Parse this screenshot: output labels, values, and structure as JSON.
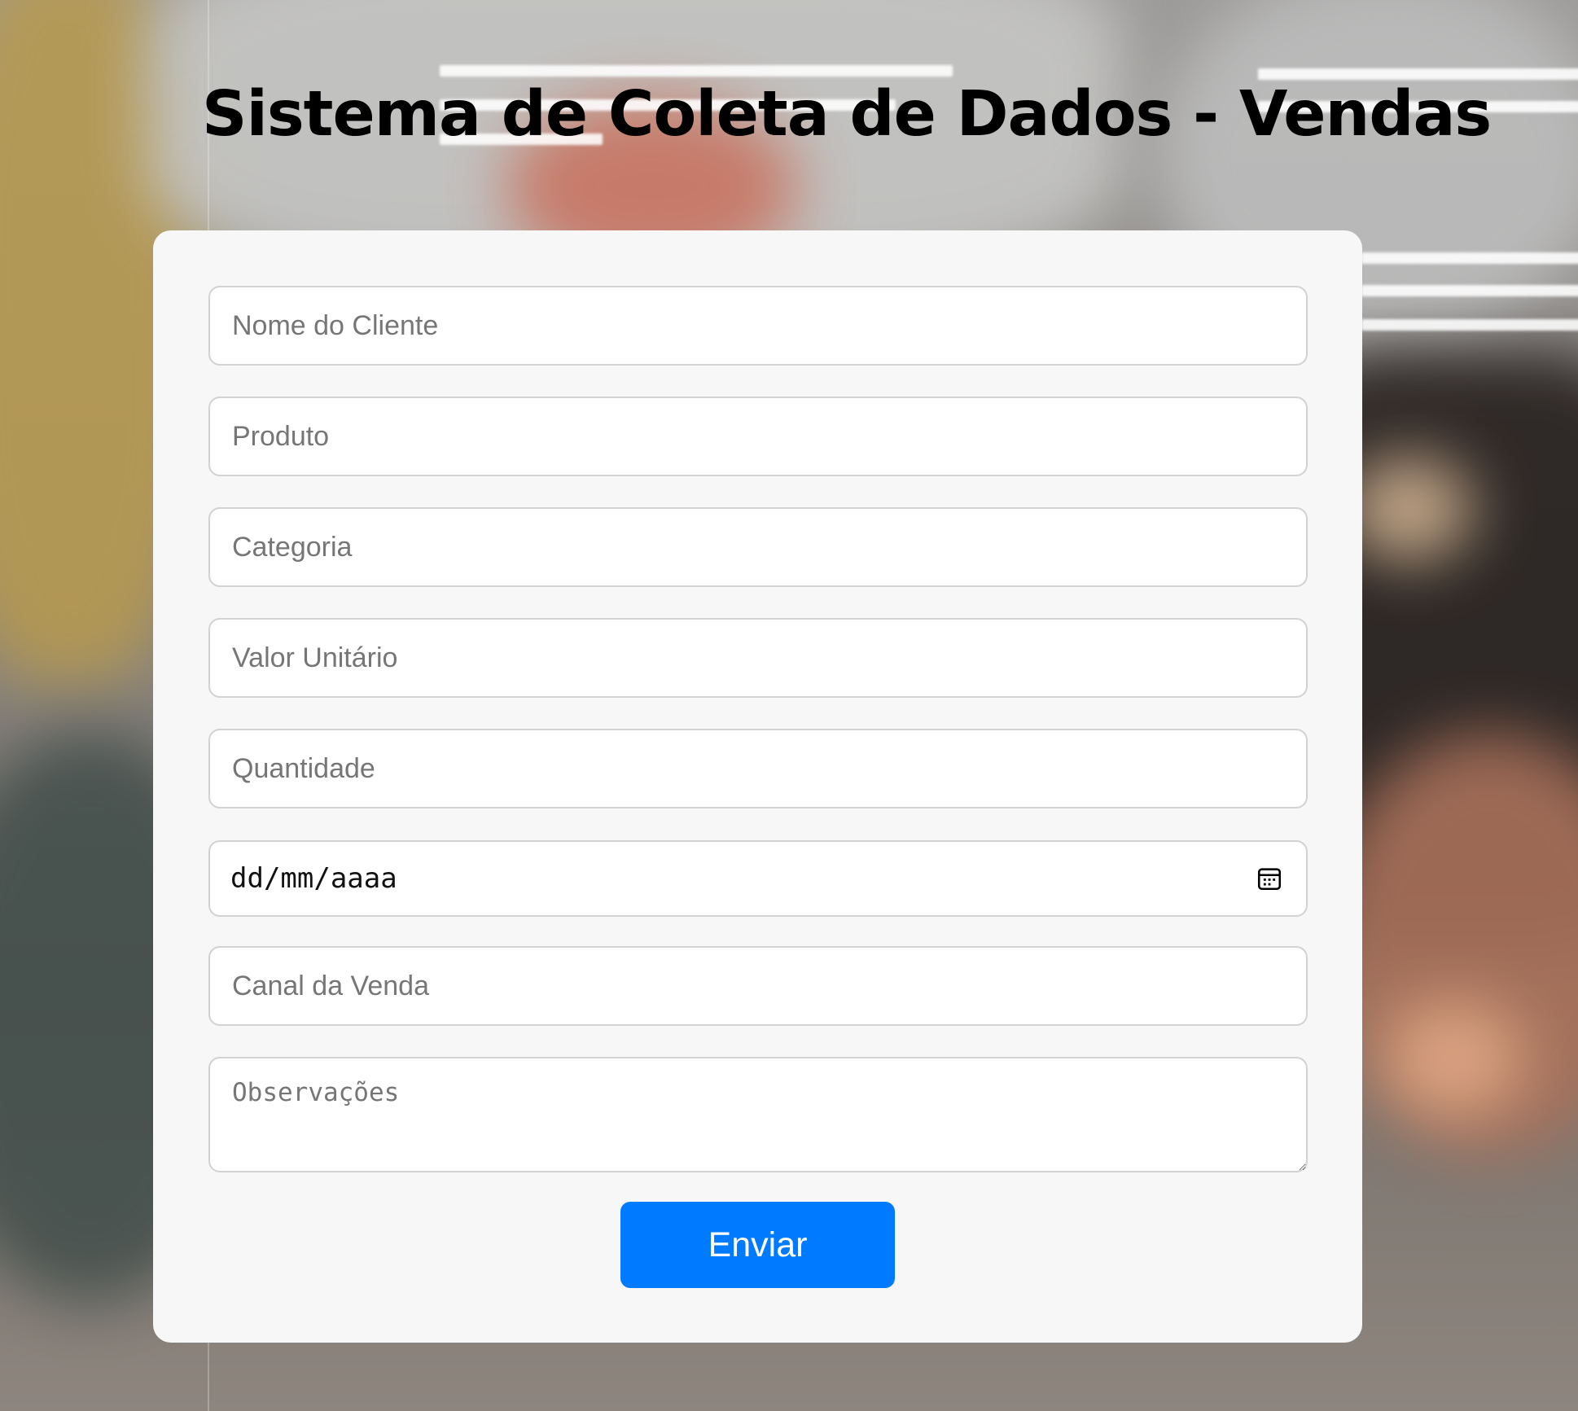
{
  "page": {
    "title": "Sistema de Coleta de Dados - Vendas"
  },
  "form": {
    "fields": [
      {
        "name": "nome-cliente",
        "placeholder": "Nome do Cliente",
        "value": ""
      },
      {
        "name": "produto",
        "placeholder": "Produto",
        "value": ""
      },
      {
        "name": "categoria",
        "placeholder": "Categoria",
        "value": ""
      },
      {
        "name": "valor-unitario",
        "placeholder": "Valor Unitário",
        "value": ""
      },
      {
        "name": "quantidade",
        "placeholder": "Quantidade",
        "value": ""
      }
    ],
    "date": {
      "display": "dd/mm/aaaa",
      "icon": "calendar-icon"
    },
    "channel": {
      "placeholder": "Canal da Venda",
      "value": ""
    },
    "notes": {
      "placeholder": "Observações",
      "value": ""
    },
    "submit_label": "Enviar"
  },
  "colors": {
    "button": "#007bff",
    "card": "#f7f7f7",
    "field_border": "#d2d2d2"
  }
}
